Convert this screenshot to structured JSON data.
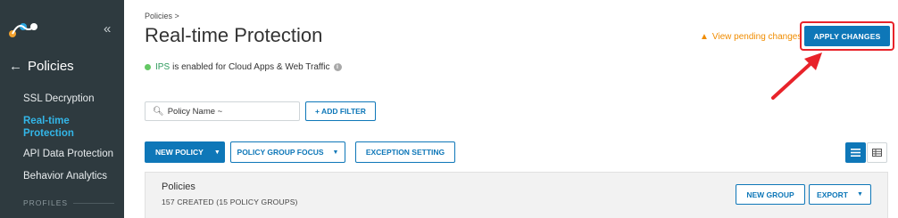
{
  "sidebar": {
    "collapse_glyph": "«",
    "back_label": "Policies",
    "items": [
      {
        "label": "SSL Decryption",
        "active": false
      },
      {
        "label": "Real-time Protection",
        "active": true
      },
      {
        "label": "API Data Protection",
        "active": false
      },
      {
        "label": "Behavior Analytics",
        "active": false
      }
    ],
    "profiles_label": "PROFILES"
  },
  "header": {
    "breadcrumb": "Policies >",
    "title": "Real-time Protection",
    "status_link": "IPS",
    "status_text": "is enabled for Cloud Apps & Web Traffic",
    "pending_label": "View pending changes",
    "apply_label": "APPLY CHANGES"
  },
  "filters": {
    "search_placeholder": "Policy Name ~",
    "add_filter_label": "+ ADD FILTER"
  },
  "toolbar": {
    "new_policy_label": "NEW POLICY",
    "group_focus_label": "POLICY GROUP FOCUS",
    "exception_label": "EXCEPTION SETTING"
  },
  "panel": {
    "title": "Policies",
    "count": "157 CREATED (15 POLICY GROUPS)",
    "new_group_label": "NEW GROUP",
    "export_label": "EXPORT"
  },
  "colors": {
    "sidebar_bg": "#2e3a3f",
    "accent_blue": "#0e77b8",
    "active_nav": "#33b6e8",
    "warning": "#f08c00",
    "highlight_red": "#e8232a"
  }
}
